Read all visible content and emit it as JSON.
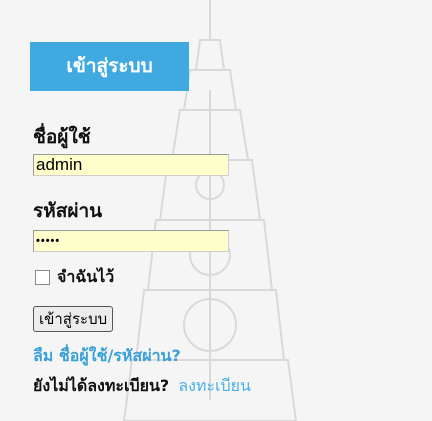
{
  "login": {
    "title": "เข้าสู่ระบบ",
    "username_label": "ชื่อผู้ใช้",
    "username_value": "admin",
    "password_label": "รหัสผ่าน",
    "password_value": "•••••",
    "remember_label": "จำฉันไว้",
    "submit_label": "เข้าสู่ระบบ",
    "forgot_link": "ลืม ชื่อผู้ใช้/รหัสผ่าน?",
    "register_question": "ยังไม่ได้ลงทะเบียน?",
    "register_link": "ลงทะเบียน"
  },
  "colors": {
    "header_bg": "#3fa9e0",
    "input_bg": "#ffffcc",
    "link": "#3aa0d8"
  }
}
